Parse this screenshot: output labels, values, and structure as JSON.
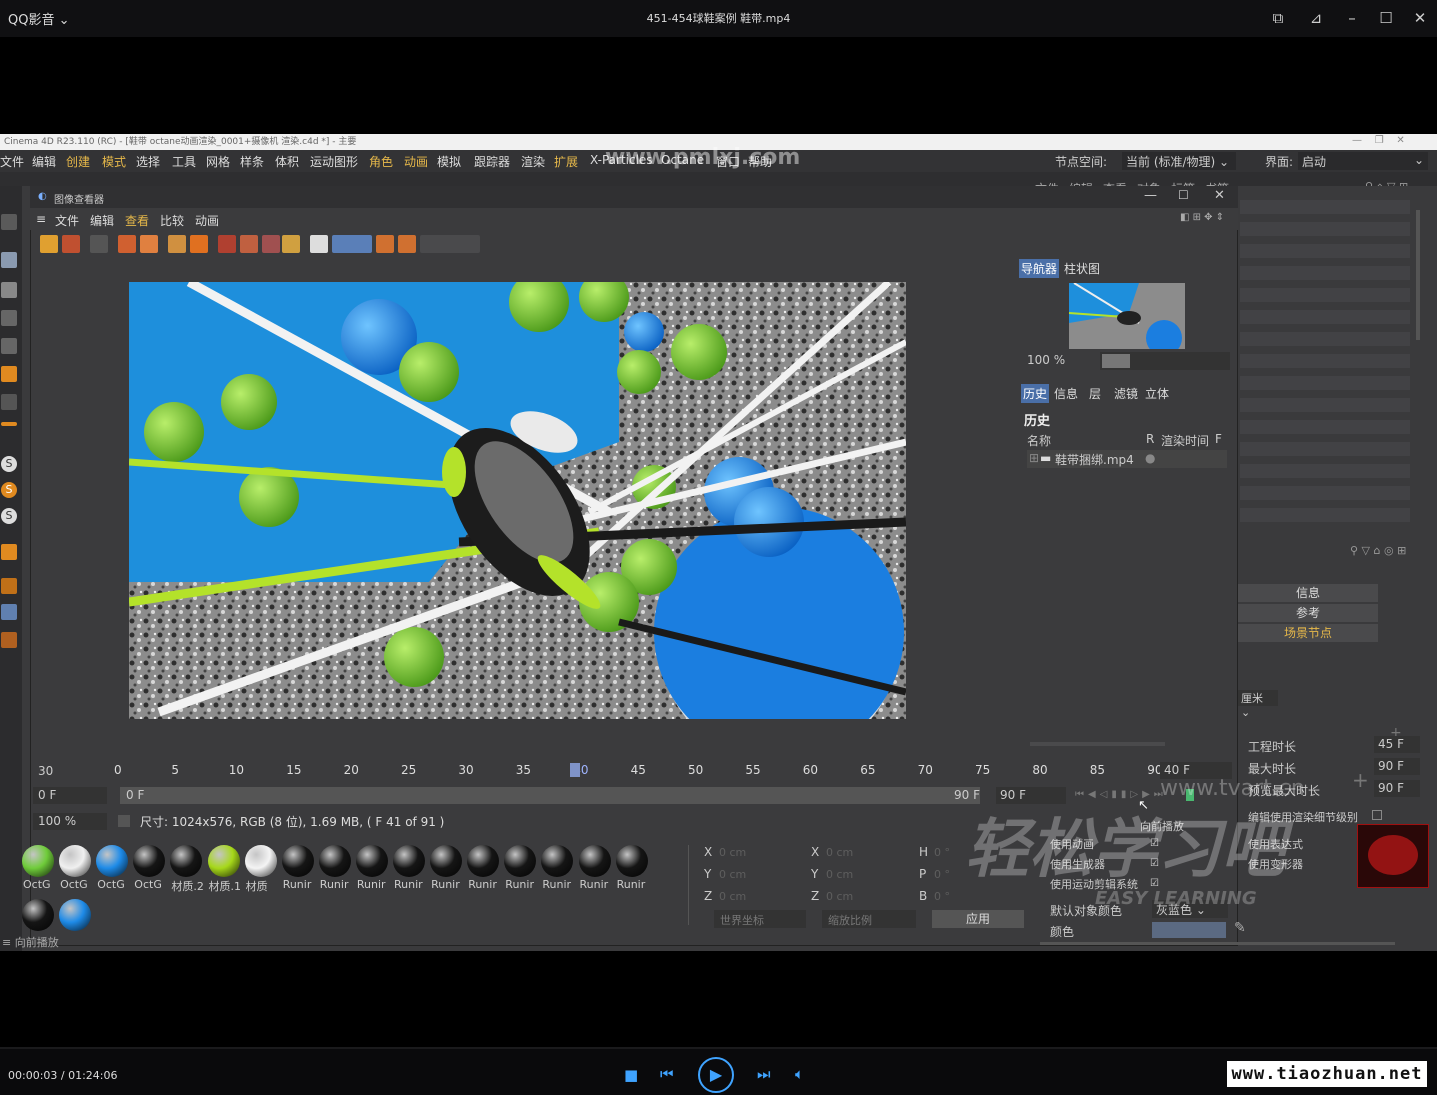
{
  "player": {
    "brand": "QQ影音",
    "brand_chevron": "chevron-down-icon",
    "title": "451-454球鞋案例 鞋带.mp4",
    "time": "00:00:03 / 01:24:06",
    "site_watermark": "www.tiaozhuan.net"
  },
  "c4d": {
    "title": "Cinema 4D R23.110 (RC) - [鞋带 octane动画渲染_0001+摄像机 渲染.c4d *] - 主要",
    "menu": [
      "文件",
      "编辑",
      "创建",
      "模式",
      "选择",
      "工具",
      "网格",
      "样条",
      "体积",
      "运动图形",
      "角色",
      "动画",
      "模拟",
      "跟踪器",
      "渲染",
      "扩展",
      "X-Particles",
      "Octane",
      "窗口",
      "帮助"
    ],
    "node_space_label": "节点空间:",
    "node_space_value": "当前 (标准/物理)",
    "layout_label": "界面:",
    "layout_value": "启动",
    "watermark": "www.pmlxj.com",
    "obj_menu": [
      "文件",
      "编辑",
      "查看",
      "对象",
      "标签",
      "书签"
    ]
  },
  "viewer": {
    "title": "图像查看器",
    "menu": [
      "文件",
      "编辑",
      "查看",
      "比较",
      "动画"
    ],
    "nav_tabs": [
      "导航器",
      "柱状图"
    ],
    "zoom": "100 %",
    "info_tabs": [
      "历史",
      "信息",
      "层",
      "滤镜",
      "立体"
    ],
    "history_heading": "历史",
    "history_cols": [
      "名称",
      "R",
      "渲染时间",
      "F"
    ],
    "history_item": "鞋带捆绑.mp4",
    "timeline_ticks": [
      "0",
      "5",
      "10",
      "15",
      "20",
      "25",
      "30",
      "35",
      "40",
      "45",
      "50",
      "55",
      "60",
      "65",
      "70",
      "75",
      "80",
      "85",
      "90"
    ],
    "current_frame_marker": "40",
    "frame_left": "30",
    "frame_right": "40 F",
    "range_start": "0 F",
    "range_start2": "0 F",
    "range_end": "90 F",
    "range_end2": "90 F",
    "zoom_bottom": "100 %",
    "status": "尺寸: 1024x576, RGB (8 位), 1.69 MB,  ( F 41 of 91 )"
  },
  "materials": {
    "row1": [
      {
        "label": "OctG",
        "color": "#6fcc3a"
      },
      {
        "label": "OctG",
        "color": "#f0f0f0"
      },
      {
        "label": "OctG",
        "color": "#1e8be8"
      },
      {
        "label": "OctG",
        "color": "#151515"
      },
      {
        "label": "材质.2",
        "color": "#151515"
      },
      {
        "label": "材质.1",
        "color": "#a6d81a"
      },
      {
        "label": "材质",
        "color": "#f4f4f4"
      },
      {
        "label": "Runir",
        "color": "#151515"
      },
      {
        "label": "Runir",
        "color": "#151515"
      },
      {
        "label": "Runir",
        "color": "#151515"
      },
      {
        "label": "Runir",
        "color": "#151515"
      },
      {
        "label": "Runir",
        "color": "#151515"
      },
      {
        "label": "Runir",
        "color": "#151515"
      },
      {
        "label": "Runir",
        "color": "#151515"
      },
      {
        "label": "Runir",
        "color": "#151515"
      },
      {
        "label": "Runir",
        "color": "#151515"
      },
      {
        "label": "Runir",
        "color": "#151515"
      }
    ],
    "row2": [
      {
        "color": "#151515"
      },
      {
        "color": "#1e8be8"
      }
    ]
  },
  "coords": {
    "labels": [
      "X",
      "Y",
      "Z",
      "X",
      "Y",
      "Z",
      "H",
      "P",
      "B"
    ],
    "values": [
      "0 cm",
      "0 cm",
      "0 cm",
      "0 cm",
      "0 cm",
      "0 cm",
      "0 °",
      "0 °",
      "0 °"
    ],
    "world": "世界坐标",
    "scale": "缩放比例",
    "apply": "应用"
  },
  "scene": {
    "buttons": [
      "信息",
      "参考",
      "场景节点"
    ],
    "unit": "厘米",
    "rows": [
      {
        "label": "工程时长",
        "value": "45 F"
      },
      {
        "label": "最大时长",
        "value": "90 F"
      },
      {
        "label": "预览最大时长",
        "value": "90 F"
      }
    ],
    "render_lod": "编辑使用渲染细节级别",
    "use_anim": "使用动画",
    "use_expr": "使用表达式",
    "use_gen": "使用生成器",
    "use_deform": "使用变形器",
    "use_motion": "使用运动剪辑系统",
    "default_color_label": "默认对象颜色",
    "default_color_value": "灰蓝色",
    "color_label": "颜色",
    "tooltip": "向前播放",
    "status_bottom": "向前播放",
    "watermark_big": "轻松学习吧",
    "watermark_sub": "EASY LEARNING",
    "watermark_url": "www.tvart.cn"
  }
}
